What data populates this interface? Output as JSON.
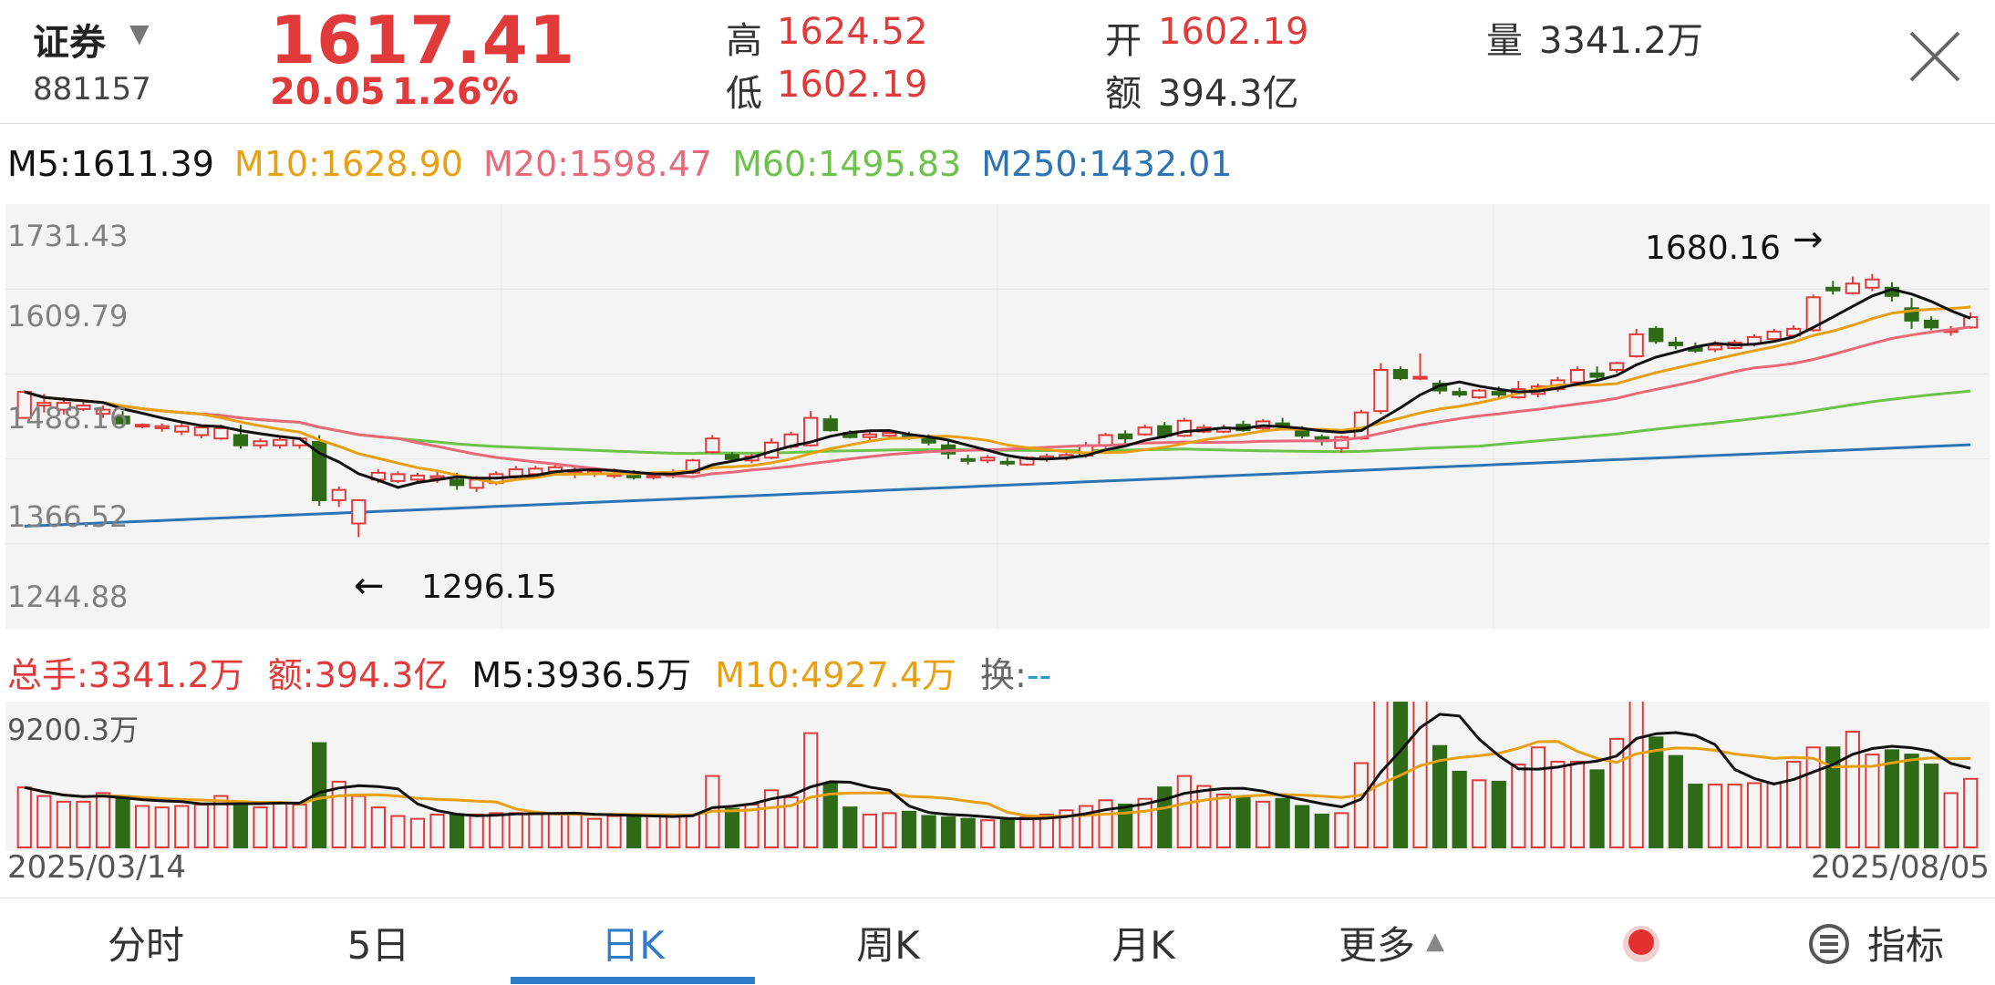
{
  "header": {
    "name": "证券",
    "code": "881157",
    "price": "1617.41",
    "change": "20.05",
    "change_pct": "1.26%",
    "high_label": "高",
    "high_value": "1624.52",
    "low_label": "低",
    "low_value": "1602.19",
    "open_label": "开",
    "open_value": "1602.19",
    "amount_label": "额",
    "amount_value": "394.3亿",
    "volume_label": "量",
    "volume_value": "3341.2万"
  },
  "ma": {
    "m5": "M5:1611.39",
    "m10": "M10:1628.90",
    "m20": "M20:1598.47",
    "m60": "M60:1495.83",
    "m250": "M250:1432.01"
  },
  "price_axis": [
    "1731.43",
    "1609.79",
    "1488.16",
    "1366.52",
    "1244.88"
  ],
  "annotations": {
    "high_mark": "1680.16",
    "high_arrow": "→",
    "low_mark": "1296.15",
    "low_arrow": "←"
  },
  "volume": {
    "total": "总手:3341.2万",
    "amount": "额:394.3亿",
    "m5": "M5:3936.5万",
    "m10": "M10:4927.4万",
    "turnover": "换:",
    "turnover_value": "--",
    "axis_max": "9200.3万"
  },
  "dates": {
    "start": "2025/03/14",
    "end": "2025/08/05"
  },
  "tabs": [
    "分时",
    "5日",
    "日K",
    "周K",
    "月K",
    "更多",
    "指标"
  ],
  "active_tab": "日K",
  "colors": {
    "up": "#e03a3a",
    "down": "#2f6b16",
    "m5": "#111111",
    "m10": "#e8a013",
    "m20": "#e8697a",
    "m60": "#6cc24a",
    "m250": "#2c74b3",
    "accent": "#2f7cc9"
  },
  "chart_data": {
    "type": "candlestick",
    "x_start": "2025/03/14",
    "x_end": "2025/08/05",
    "y_ticks": [
      1731.43,
      1609.79,
      1488.16,
      1366.52,
      1244.88
    ],
    "ylim": [
      1244.88,
      1731.43
    ],
    "ohlc": [
      [
        1470,
        1510,
        1478,
        1508
      ],
      [
        1488,
        1505,
        1478,
        1492
      ],
      [
        1482,
        1500,
        1475,
        1492
      ],
      [
        1483,
        1495,
        1480,
        1488
      ],
      [
        1476,
        1488,
        1470,
        1482
      ],
      [
        1472,
        1480,
        1458,
        1462
      ],
      [
        1458,
        1462,
        1455,
        1460
      ],
      [
        1455,
        1462,
        1450,
        1458
      ],
      [
        1450,
        1462,
        1445,
        1458
      ],
      [
        1445,
        1458,
        1440,
        1456
      ],
      [
        1440,
        1460,
        1438,
        1455
      ],
      [
        1445,
        1460,
        1425,
        1430
      ],
      [
        1430,
        1440,
        1425,
        1436
      ],
      [
        1430,
        1442,
        1425,
        1438
      ],
      [
        1430,
        1442,
        1425,
        1440
      ],
      [
        1435,
        1445,
        1342,
        1350
      ],
      [
        1350,
        1370,
        1340,
        1365
      ],
      [
        1316,
        1350,
        1296,
        1350
      ],
      [
        1380,
        1395,
        1375,
        1390
      ],
      [
        1378,
        1392,
        1375,
        1388
      ],
      [
        1380,
        1390,
        1376,
        1386
      ],
      [
        1382,
        1392,
        1375,
        1385
      ],
      [
        1380,
        1390,
        1365,
        1372
      ],
      [
        1368,
        1385,
        1362,
        1380
      ],
      [
        1375,
        1392,
        1372,
        1388
      ],
      [
        1385,
        1400,
        1380,
        1395
      ],
      [
        1388,
        1400,
        1384,
        1396
      ],
      [
        1392,
        1402,
        1388,
        1398
      ],
      [
        1390,
        1400,
        1382,
        1392
      ],
      [
        1388,
        1398,
        1384,
        1392
      ],
      [
        1388,
        1396,
        1382,
        1388
      ],
      [
        1386,
        1394,
        1380,
        1384
      ],
      [
        1384,
        1392,
        1380,
        1386
      ],
      [
        1385,
        1395,
        1382,
        1390
      ],
      [
        1390,
        1410,
        1388,
        1408
      ],
      [
        1420,
        1445,
        1418,
        1440
      ],
      [
        1416,
        1420,
        1408,
        1410
      ],
      [
        1408,
        1418,
        1404,
        1414
      ],
      [
        1412,
        1440,
        1410,
        1434
      ],
      [
        1428,
        1450,
        1425,
        1446
      ],
      [
        1430,
        1480,
        1428,
        1470
      ],
      [
        1468,
        1474,
        1450,
        1452
      ],
      [
        1448,
        1452,
        1440,
        1442
      ],
      [
        1442,
        1450,
        1438,
        1446
      ],
      [
        1444,
        1452,
        1440,
        1448
      ],
      [
        1444,
        1450,
        1438,
        1442
      ],
      [
        1440,
        1446,
        1430,
        1434
      ],
      [
        1430,
        1438,
        1410,
        1418
      ],
      [
        1410,
        1416,
        1402,
        1408
      ],
      [
        1408,
        1416,
        1404,
        1412
      ],
      [
        1406,
        1412,
        1400,
        1404
      ],
      [
        1402,
        1414,
        1400,
        1412
      ],
      [
        1410,
        1418,
        1406,
        1414
      ],
      [
        1412,
        1420,
        1408,
        1416
      ],
      [
        1415,
        1435,
        1412,
        1430
      ],
      [
        1430,
        1448,
        1426,
        1445
      ],
      [
        1446,
        1452,
        1432,
        1440
      ],
      [
        1446,
        1460,
        1444,
        1456
      ],
      [
        1458,
        1464,
        1440,
        1444
      ],
      [
        1444,
        1470,
        1442,
        1466
      ],
      [
        1450,
        1460,
        1448,
        1456
      ],
      [
        1450,
        1460,
        1448,
        1455
      ],
      [
        1460,
        1466,
        1450,
        1452
      ],
      [
        1455,
        1468,
        1452,
        1465
      ],
      [
        1462,
        1470,
        1455,
        1458
      ],
      [
        1454,
        1458,
        1440,
        1444
      ],
      [
        1442,
        1446,
        1430,
        1436
      ],
      [
        1426,
        1444,
        1420,
        1442
      ],
      [
        1440,
        1482,
        1438,
        1478
      ],
      [
        1480,
        1550,
        1476,
        1540
      ],
      [
        1540,
        1545,
        1525,
        1528
      ],
      [
        1528,
        1564,
        1525,
        1530
      ],
      [
        1520,
        1525,
        1505,
        1510
      ],
      [
        1508,
        1514,
        1500,
        1504
      ],
      [
        1500,
        1512,
        1498,
        1510
      ],
      [
        1508,
        1516,
        1500,
        1504
      ],
      [
        1500,
        1524,
        1498,
        1512
      ],
      [
        1505,
        1520,
        1500,
        1516
      ],
      [
        1512,
        1530,
        1508,
        1525
      ],
      [
        1522,
        1545,
        1520,
        1540
      ],
      [
        1535,
        1545,
        1525,
        1530
      ],
      [
        1540,
        1552,
        1536,
        1550
      ],
      [
        1560,
        1600,
        1558,
        1592
      ],
      [
        1600,
        1604,
        1578,
        1582
      ],
      [
        1580,
        1588,
        1570,
        1576
      ],
      [
        1572,
        1580,
        1565,
        1568
      ],
      [
        1570,
        1582,
        1566,
        1576
      ],
      [
        1572,
        1584,
        1570,
        1580
      ],
      [
        1578,
        1592,
        1574,
        1588
      ],
      [
        1585,
        1600,
        1582,
        1596
      ],
      [
        1590,
        1605,
        1588,
        1600
      ],
      [
        1598,
        1650,
        1596,
        1646
      ],
      [
        1660,
        1670,
        1650,
        1656
      ],
      [
        1652,
        1676,
        1650,
        1666
      ],
      [
        1660,
        1680,
        1655,
        1672
      ],
      [
        1660,
        1668,
        1640,
        1648
      ],
      [
        1630,
        1645,
        1600,
        1612
      ],
      [
        1612,
        1618,
        1598,
        1602
      ],
      [
        1596,
        1604,
        1590,
        1598
      ],
      [
        1602,
        1624,
        1600,
        1617
      ]
    ],
    "volume": [
      4200,
      3600,
      3200,
      3200,
      3800,
      3600,
      2900,
      2800,
      2900,
      3000,
      3600,
      3000,
      2800,
      3100,
      3000,
      7300,
      4600,
      3600,
      2800,
      2200,
      2000,
      2300,
      2300,
      2300,
      2400,
      2400,
      2400,
      2400,
      2400,
      2000,
      2200,
      2200,
      2200,
      2200,
      2300,
      5000,
      2700,
      3000,
      4000,
      3500,
      8000,
      4500,
      2800,
      2300,
      2400,
      2500,
      2200,
      2100,
      2000,
      1900,
      1900,
      2100,
      2300,
      2600,
      2900,
      3300,
      3000,
      3400,
      4200,
      5000,
      4300,
      3700,
      3500,
      3200,
      3400,
      2900,
      2300,
      2400,
      5900,
      12800,
      10400,
      10400,
      7100,
      5300,
      4700,
      4600,
      5800,
      7000,
      6000,
      6000,
      5400,
      7600,
      13100,
      7700,
      6400,
      4400,
      4400,
      4400,
      4500,
      4500,
      6000,
      7000,
      7000,
      8100,
      6500,
      6800,
      6500,
      5800,
      3800,
      4800
    ],
    "volume_max": 9200.3
  }
}
